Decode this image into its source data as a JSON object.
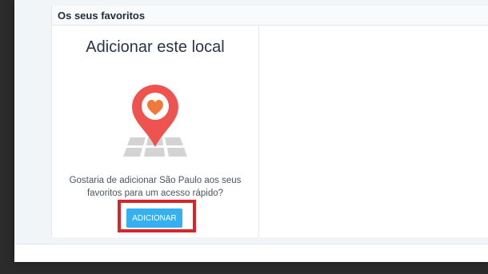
{
  "favorites": {
    "header": "Os seus favoritos",
    "card": {
      "title": "Adicionar este local",
      "illustration_icon": "location-heart-pin-icon",
      "text_line1": "Gostaria de adicionar São Paulo aos seus",
      "text_line2": "favoritos para um acesso rápido?",
      "button_label": "ADICIONAR"
    }
  },
  "colors": {
    "button": "#34b1f0",
    "pin": "#ef5350",
    "highlight": "#d7262b"
  }
}
